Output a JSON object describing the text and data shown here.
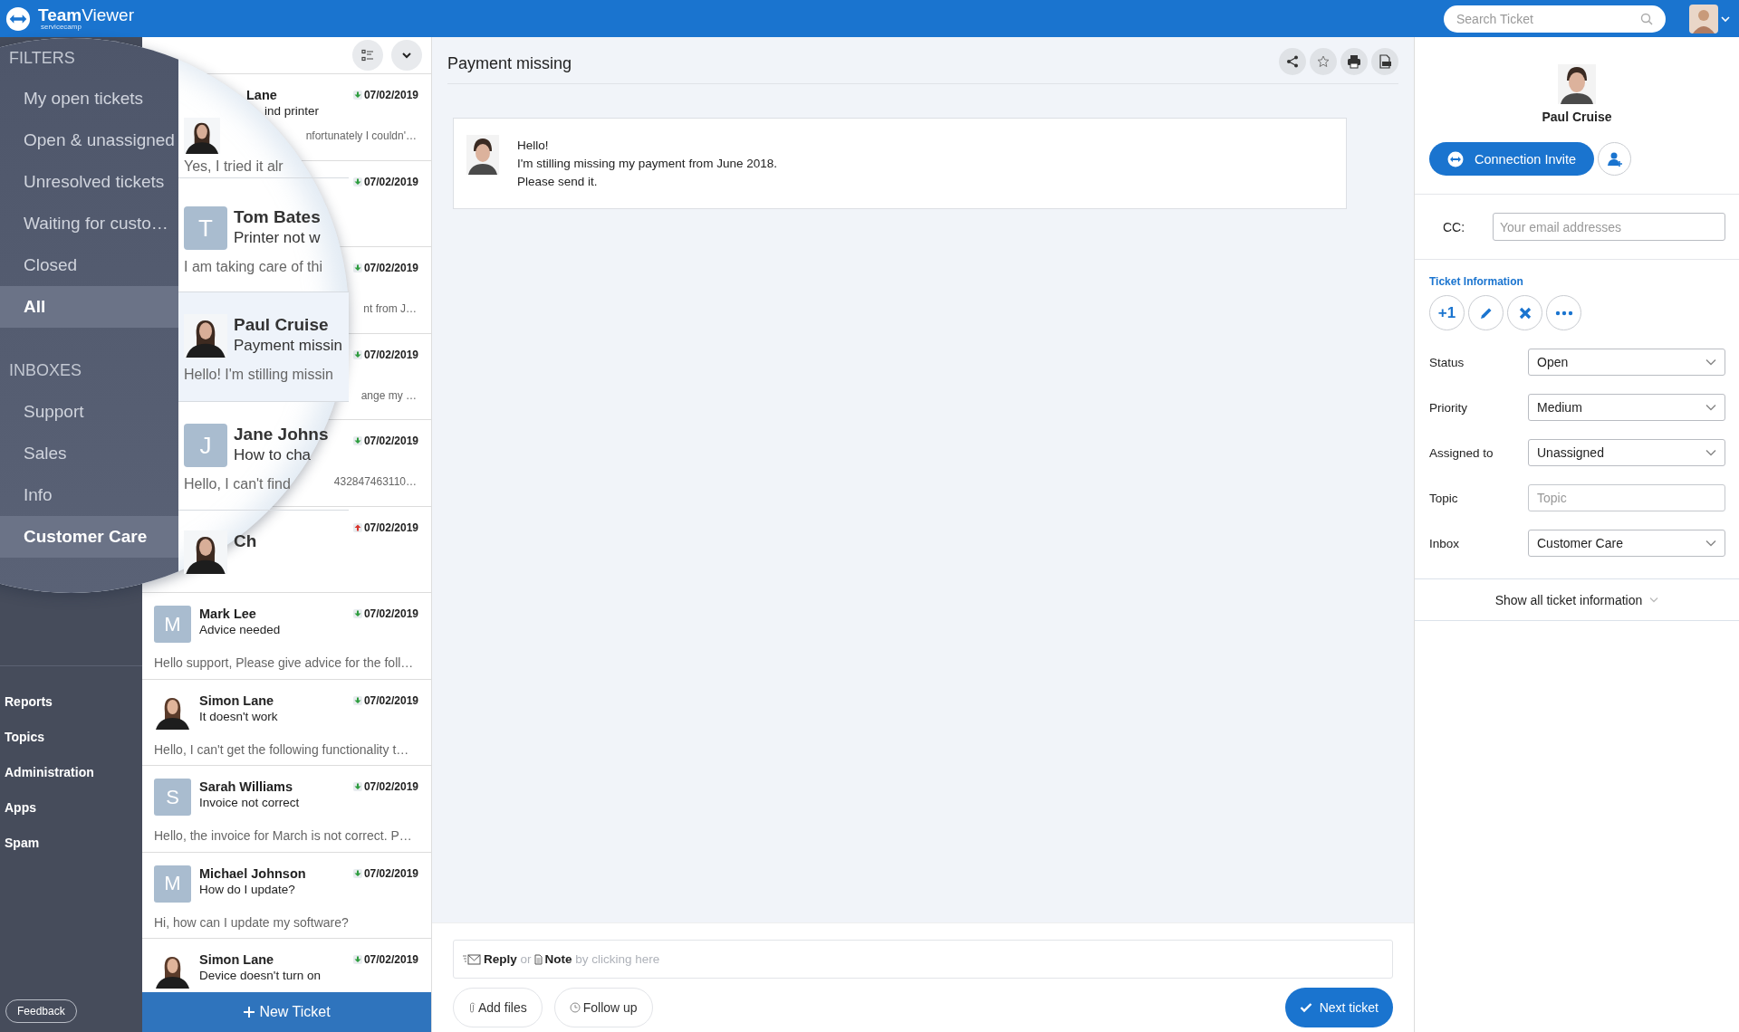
{
  "top_bar": {
    "brand": "**Team**Viewer",
    "brand_sub": "servicecamp",
    "search": {
      "placeholder": "Search Ticket"
    }
  },
  "sidebar": {
    "nav": [
      {
        "label": "Reports"
      },
      {
        "label": "Topics"
      },
      {
        "label": "Administration"
      },
      {
        "label": "Apps"
      },
      {
        "label": "Spam"
      }
    ],
    "feedback": "Feedback"
  },
  "ticket_list": {
    "covered_rows": [
      {
        "name": "Lane",
        "subject": "ind printer",
        "preview": "nfortunately I couldn'…",
        "date": "07/02/2019",
        "high_priority": false
      },
      {
        "date": "07/02/2019",
        "high_priority": false
      },
      {
        "preview": "nt from J…",
        "date": "07/02/2019",
        "high_priority": false
      },
      {
        "preview": "ange my …",
        "date": "07/02/2019",
        "high_priority": false
      },
      {
        "preview": "432847463110…",
        "date": "07/02/2019",
        "high_priority": false
      },
      {
        "date": "07/02/2019",
        "high_priority": true
      }
    ],
    "rows": [
      {
        "selected": false,
        "avatar": {
          "kind": "letter",
          "letter": "M"
        },
        "name": "Mark Lee",
        "subject": "Advice needed",
        "preview": "Hello support, Please give advice for the foll…",
        "date": "07/02/2019",
        "high_priority": false
      },
      {
        "selected": false,
        "avatar": {
          "kind": "photo"
        },
        "name": "Simon Lane",
        "subject": "It doesn't work",
        "preview": "Hello, I can't get the following functionality t…",
        "date": "07/02/2019",
        "high_priority": false
      },
      {
        "selected": false,
        "avatar": {
          "kind": "letter",
          "letter": "S"
        },
        "name": "Sarah Williams",
        "subject": "Invoice not correct",
        "preview": "Hello, the invoice for March is not correct. P…",
        "date": "07/02/2019",
        "high_priority": false
      },
      {
        "selected": false,
        "avatar": {
          "kind": "letter",
          "letter": "M"
        },
        "name": "Michael Johnson",
        "subject": "How do I update?",
        "preview": "Hi, how can I update my software?",
        "date": "07/02/2019",
        "high_priority": false
      },
      {
        "selected": false,
        "avatar": {
          "kind": "photo"
        },
        "name": "Simon Lane",
        "subject": "Device doesn't turn on",
        "date": "07/02/2019",
        "high_priority": false
      }
    ],
    "new_ticket": "New Ticket"
  },
  "magnifier": {
    "filters_heading": "FILTERS",
    "filters": [
      {
        "label": "My open tickets",
        "selected": false
      },
      {
        "label": "Open & unassigned",
        "selected": false
      },
      {
        "label": "Unresolved tickets",
        "selected": false
      },
      {
        "label": "Waiting for custo…",
        "selected": false
      },
      {
        "label": "Closed",
        "selected": false
      },
      {
        "label": "All",
        "selected": true
      }
    ],
    "inboxes_heading": "INBOXES",
    "inboxes": [
      {
        "label": "Support",
        "selected": false
      },
      {
        "label": "Sales",
        "selected": false
      },
      {
        "label": "Info",
        "selected": false
      },
      {
        "label": "Customer Care",
        "selected": true
      }
    ],
    "tickets": [
      {
        "avatar": {
          "kind": "photo"
        },
        "preview": "Yes, I tried it alr",
        "selected": false
      },
      {
        "avatar": {
          "kind": "letter",
          "letter": "T"
        },
        "name": "Tom Bates",
        "subject": "Printer not w",
        "preview": "I am taking care of thi",
        "selected": false
      },
      {
        "avatar": {
          "kind": "photo"
        },
        "name": "Paul Cruise",
        "subject": "Payment missin",
        "preview": "Hello! I'm stilling missin",
        "selected": true
      },
      {
        "avatar": {
          "kind": "letter",
          "letter": "J"
        },
        "name": "Jane Johns",
        "subject": "How to cha",
        "preview": "Hello, I can't find",
        "selected": false
      },
      {
        "avatar": {
          "kind": "photo"
        },
        "name": "Ch",
        "selected": false
      }
    ]
  },
  "ticket": {
    "title": "Payment missing",
    "tools": [
      {
        "kind": "share"
      },
      {
        "kind": "star"
      },
      {
        "kind": "print"
      },
      {
        "kind": "log"
      }
    ],
    "message": [
      "Hello!",
      "I'm stilling missing my payment from June 2018.",
      "Please send it."
    ],
    "reply": [
      "**Reply** or",
      "**Note** by clicking here"
    ],
    "add_files": "Add files",
    "follow_up": "Follow up",
    "next": "Next ticket"
  },
  "contact": {
    "name": "Paul Cruise",
    "invite": "Connection Invite",
    "cc_label": "CC:",
    "cc_placeholder": "Your email addresses",
    "info_heading": "Ticket Information",
    "actions": [
      {
        "kind": "text",
        "text": "+1"
      },
      {
        "kind": "edit"
      },
      {
        "kind": "close"
      },
      {
        "kind": "more"
      }
    ],
    "fields": [
      {
        "label": "Status",
        "kind": "select",
        "value": "Open"
      },
      {
        "label": "Priority",
        "kind": "select",
        "value": "Medium"
      },
      {
        "label": "Assigned to",
        "kind": "select",
        "value": "Unassigned"
      },
      {
        "label": "Topic",
        "kind": "text",
        "placeholder": "Topic"
      },
      {
        "label": "Inbox",
        "kind": "select",
        "value": "Customer Care"
      }
    ],
    "show_all": "Show all ticket information"
  }
}
